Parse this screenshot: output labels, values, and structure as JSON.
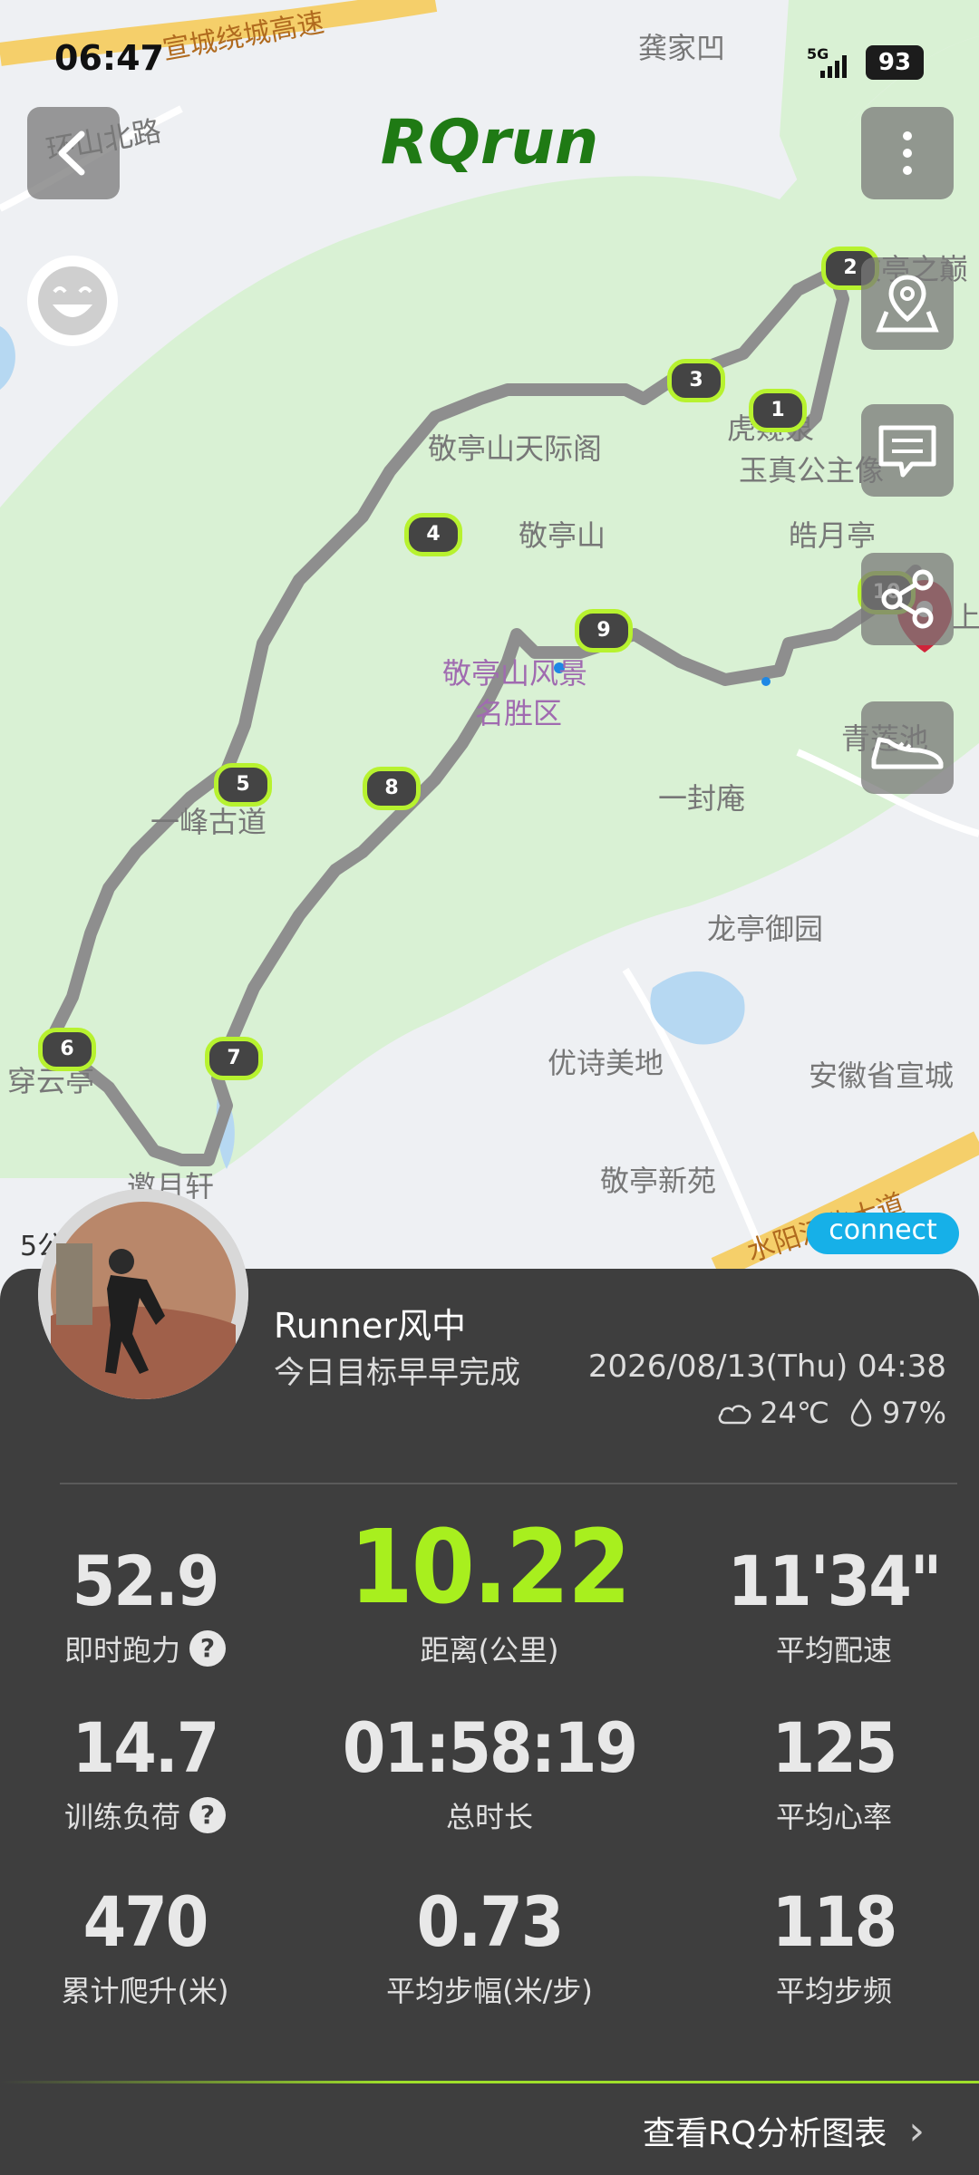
{
  "status": {
    "time": "06:47",
    "network": "5G",
    "battery": "93"
  },
  "header": {
    "app_title": "RQrun"
  },
  "map": {
    "labels": {
      "road_top": "宣城绕城高速",
      "village": "龚家凹",
      "road_left": "环山北路",
      "peak": "敬亭之巅",
      "tianji": "敬亭山天际阁",
      "hu": "虎窥泉",
      "yuzhen": "玉真公主像",
      "jingting": "敬亭山",
      "haoyue": "皓月亭",
      "shang": "上",
      "scenic1": "敬亭山风景",
      "scenic2": "名胜区",
      "qinglian": "青莲池",
      "yifeng": "一峰古道",
      "yifengan": "一封庵",
      "longting": "龙亭御园",
      "chuanyun": "穿云亭",
      "youshi": "优诗美地",
      "anhui": "安徽省宣城",
      "aoyue": "邀月轩",
      "xinyuan": "敬亭新苑",
      "road_bottom": "水阳江北大道"
    },
    "markers": [
      "1",
      "2",
      "3",
      "4",
      "5",
      "6",
      "7",
      "8",
      "9",
      "10"
    ],
    "scale_label": "5公",
    "connect_label": "connect"
  },
  "profile": {
    "name": "Runner风中",
    "goal_text": "今日目标早早完成",
    "datetime": "2026/08/13(Thu) 04:38",
    "temperature": "24℃",
    "humidity": "97%"
  },
  "stats": [
    {
      "value": "52.9",
      "label": "即时跑力",
      "help": "?"
    },
    {
      "value": "10.22",
      "label": "距离(公里)"
    },
    {
      "value": "11'34\"",
      "label": "平均配速"
    },
    {
      "value": "14.7",
      "label": "训练负荷",
      "help": "?"
    },
    {
      "value": "01:58:19",
      "label": "总时长"
    },
    {
      "value": "125",
      "label": "平均心率"
    },
    {
      "value": "470",
      "label": "累计爬升(米)"
    },
    {
      "value": "0.73",
      "label": "平均步幅(米/步)"
    },
    {
      "value": "118",
      "label": "平均步频"
    }
  ],
  "footer": {
    "analysis_link": "查看RQ分析图表",
    "chevron": "›"
  },
  "icons": [
    "back-icon",
    "more-icon",
    "smile-face-icon",
    "location-icon",
    "message-icon",
    "share-icon",
    "shoe-icon",
    "cloud-icon",
    "drop-icon",
    "help-icon",
    "chevron-right-icon"
  ]
}
